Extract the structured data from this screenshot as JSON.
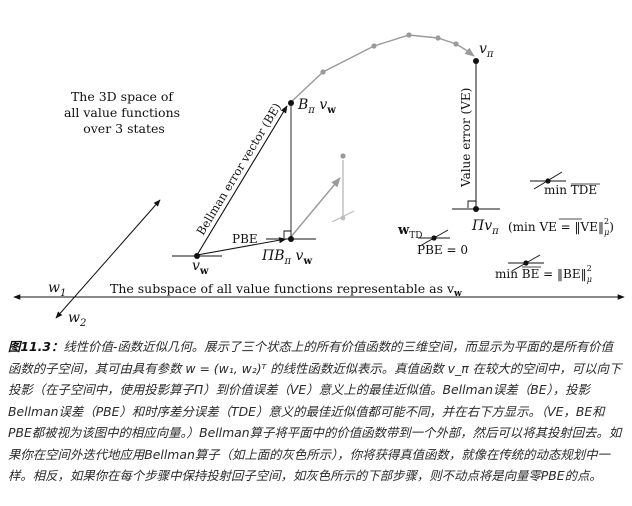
{
  "figure": {
    "space_label": [
      "The 3D space of",
      "all value functions",
      "over 3 states"
    ],
    "subspace_label": "The subspace of all value functions representable as v",
    "subspace_label_sub": "w",
    "axis_w1": "w",
    "axis_w1_sub": "1",
    "axis_w2": "w",
    "axis_w2_sub": "2",
    "v_pi_label": "v",
    "v_pi_sub": "π",
    "B_pi_v_label": "B",
    "B_pi_v_rest": "π v",
    "B_pi_v_sub": "w",
    "be_label": "Bellman error vector (BE)",
    "pbe_label": "PBE",
    "v_w_label": "v",
    "v_w_sub": "w",
    "pi_B_label": "ΠB",
    "pi_B_rest": "π v",
    "pi_B_sub": "w",
    "ve_label": "Value error (VE)",
    "pi_v_label": "Πv",
    "pi_v_sub": "π",
    "pi_v_min": "(min VE = ‖VE‖",
    "pi_v_min_sup": "2",
    "pi_v_min_subscript": "μ",
    "pi_v_min_close": ")",
    "w_td_label": "w",
    "w_td_sub": "TD",
    "pbe_zero_label": "PBE = 0",
    "min_tde_label": "min TDE",
    "min_be_label": "min BE = ‖BE‖",
    "min_be_sup": "2",
    "min_be_sub": "μ"
  },
  "caption": {
    "label": "图11.3：",
    "text": "线性价值-函数近似几何。展示了三个状态上的所有价值函数的三维空间，而显示为平面的是所有价值函数的子空间，其可由具有参数 w = (w₁, w₂)ᵀ 的线性函数近似表示。真值函数 v_π 在较大的空间中，可以向下投影（在子空间中，使用投影算子Π）到价值误差（VE）意义上的最佳近似值。Bellman误差（BE），投影Bellman误差（PBE）和时序差分误差（TDE）意义的最佳近似值都可能不同，并在右下方显示。（VE，BE和PBE都被视为该图中的相应向量。）Bellman算子将平面中的价值函数带到一个外部，然后可以将其投射回去。如果你在空间外迭代地应用Bellman算子（如上面的灰色所示），你将获得真值函数，就像在传统的动态规划中一样。相反，如果你在每个步骤中保持投射回子空间，如灰色所示的下部步骤，则不动点将是向量零PBE的点。"
  },
  "colors": {
    "ink": "#111111",
    "gray": "#9a9a9a",
    "light_gray": "#bdbdbd"
  }
}
